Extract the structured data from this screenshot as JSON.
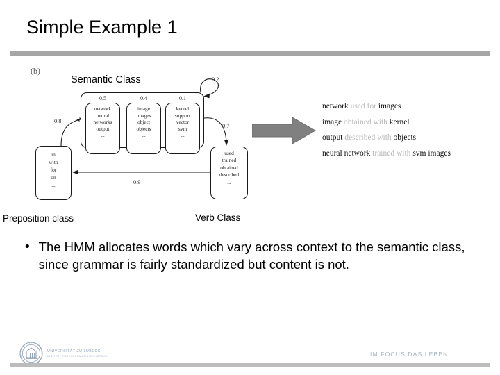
{
  "slide": {
    "title": "Simple Example 1"
  },
  "figure": {
    "panel_label": "(b)",
    "semantic_class_title": "Semantic Class",
    "semantic_states": [
      {
        "probability": "0.5",
        "words": [
          "network",
          "neural",
          "networks",
          "output",
          "..."
        ]
      },
      {
        "probability": "0.4",
        "words": [
          "image",
          "images",
          "object",
          "objects",
          "..."
        ]
      },
      {
        "probability": "0.1",
        "words": [
          "kernel",
          "support",
          "vector",
          "svm",
          "..."
        ]
      }
    ],
    "preposition_state": {
      "words": [
        "in",
        "with",
        "for",
        "on",
        "..."
      ]
    },
    "verb_state": {
      "words": [
        "used",
        "trained",
        "obtained",
        "described",
        "..."
      ]
    },
    "transitions": [
      {
        "name": "prep-to-semantic",
        "label": "0.8"
      },
      {
        "name": "verb-to-prep",
        "label": "0.9"
      },
      {
        "name": "semantic-to-verb",
        "label": "0.7"
      },
      {
        "name": "semantic-self-loop",
        "label": "0.2"
      }
    ],
    "captions": {
      "preposition": "Preposition class",
      "verb": "Verb Class"
    },
    "generated_sentences": [
      [
        {
          "text": "network",
          "style": "dark"
        },
        {
          "text": "used",
          "style": "gray"
        },
        {
          "text": "for",
          "style": "gray"
        },
        {
          "text": "images",
          "style": "dark"
        }
      ],
      [
        {
          "text": "image",
          "style": "dark"
        },
        {
          "text": "obtained",
          "style": "gray"
        },
        {
          "text": "with",
          "style": "gray"
        },
        {
          "text": "kernel",
          "style": "dark"
        }
      ],
      [
        {
          "text": "output",
          "style": "dark"
        },
        {
          "text": "described",
          "style": "gray"
        },
        {
          "text": "with",
          "style": "gray"
        },
        {
          "text": "objects",
          "style": "dark"
        }
      ],
      [
        {
          "text": "neural",
          "style": "dark"
        },
        {
          "text": "network",
          "style": "dark"
        },
        {
          "text": "trained",
          "style": "gray"
        },
        {
          "text": "with",
          "style": "gray"
        },
        {
          "text": "svm",
          "style": "dark"
        },
        {
          "text": "images",
          "style": "dark"
        }
      ]
    ]
  },
  "body": {
    "bullet_marker": "•",
    "bullet_text": "The HMM allocates words which vary across context to the semantic class, since grammar is fairly standardized but content is not."
  },
  "footer": {
    "university_line1": "UNIVERSITÄT ZU LÜBECK",
    "university_line2": "INSTITUT FÜR INFORMATIONSSYSTEME",
    "slogan": "IM FOCUS DAS LEBEN"
  },
  "colors": {
    "rule_gray": "#a6a6a6",
    "footer_rule_gray": "#bcbcbc",
    "block_arrow_gray": "#808080",
    "function_word_gray": "#b9b9b9",
    "footer_text_blue": "#93a3b5"
  }
}
